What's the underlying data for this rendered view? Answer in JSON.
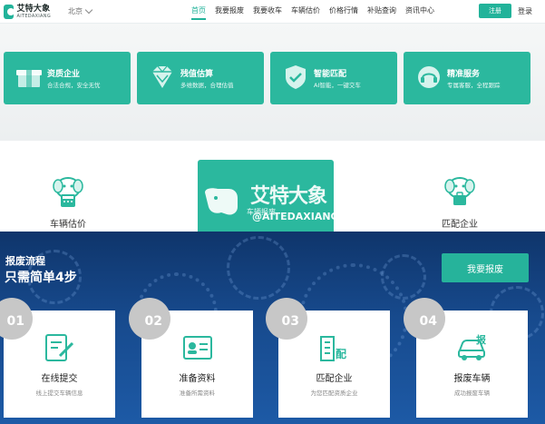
{
  "header": {
    "logo_cn": "艾特大象",
    "logo_en": "AITEDAXIANG",
    "city": "北京",
    "nav": [
      {
        "label": "首页",
        "active": true
      },
      {
        "label": "我要报废",
        "active": false
      },
      {
        "label": "我要收车",
        "active": false
      },
      {
        "label": "车辆估价",
        "active": false
      },
      {
        "label": "价格行情",
        "active": false
      },
      {
        "label": "补贴查询",
        "active": false
      },
      {
        "label": "资讯中心",
        "active": false
      }
    ],
    "register": "注册",
    "login": "登录"
  },
  "features": [
    {
      "title": "资质企业",
      "subtitle": "合法合规，安全无忧",
      "icon": "box-icon"
    },
    {
      "title": "残值估算",
      "subtitle": "多维数据，合理估值",
      "icon": "gem-icon"
    },
    {
      "title": "智能匹配",
      "subtitle": "AI智能，一键交车",
      "icon": "shield-check-icon"
    },
    {
      "title": "精准服务",
      "subtitle": "专属客服，全程跟踪",
      "icon": "headset-icon"
    }
  ],
  "services": {
    "left": "车辆估价",
    "center": "车辆报废",
    "right": "匹配企业"
  },
  "watermark": {
    "cn": "艾特大象",
    "en": "@AITEDAXIANG"
  },
  "process": {
    "title": "报废流程",
    "subtitle": "只需简单4步",
    "button": "我要报废",
    "steps": [
      {
        "num": "01",
        "title": "在线提交",
        "desc": "线上提交车辆信息"
      },
      {
        "num": "02",
        "title": "准备资料",
        "desc": "准备所需资料"
      },
      {
        "num": "03",
        "title": "匹配企业",
        "desc": "为您匹配资质企业"
      },
      {
        "num": "04",
        "title": "报废车辆",
        "desc": "成功报废车辆"
      }
    ]
  },
  "colors": {
    "accent": "#2bb89e",
    "navy": "#174a8d"
  }
}
